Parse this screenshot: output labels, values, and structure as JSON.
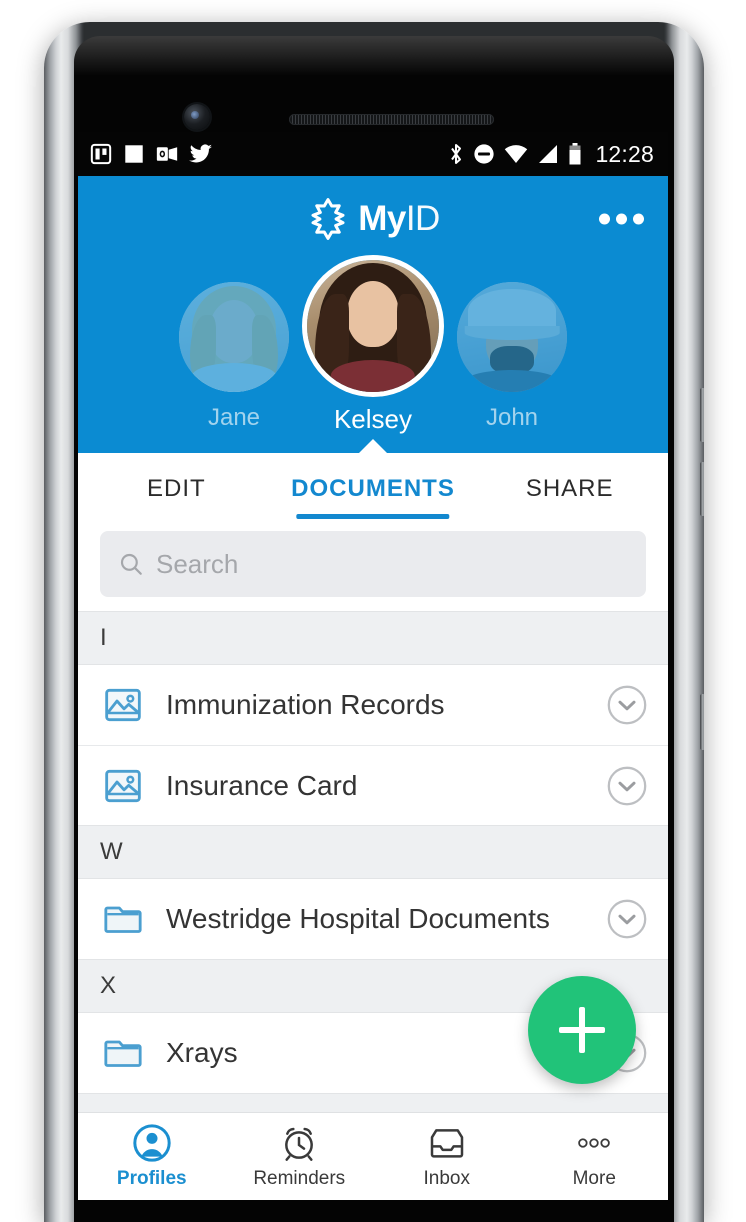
{
  "status_bar": {
    "left_icons": [
      "trello-icon",
      "white-square-icon",
      "outlook-icon",
      "twitter-icon"
    ],
    "right_icons": [
      "bluetooth-icon",
      "do-not-disturb-icon",
      "wifi-icon",
      "cellular-signal-icon",
      "battery-icon"
    ],
    "clock": "12:28"
  },
  "header": {
    "brand_my": "My",
    "brand_id": "ID",
    "logo_icon": "star-of-life-icon",
    "overflow_icon": "more-options-icon",
    "accent_color": "#0b8bd2"
  },
  "profiles": [
    {
      "name": "Jane",
      "active": false
    },
    {
      "name": "Kelsey",
      "active": true
    },
    {
      "name": "John",
      "active": false
    }
  ],
  "tabs": [
    {
      "label": "EDIT",
      "active": false
    },
    {
      "label": "DOCUMENTS",
      "active": true
    },
    {
      "label": "SHARE",
      "active": false
    }
  ],
  "search": {
    "icon": "search-icon",
    "placeholder": "Search",
    "value": ""
  },
  "documents": [
    {
      "section": "I",
      "items": [
        {
          "title": "Immunization Records",
          "icon": "image-icon",
          "expand_icon": "chevron-down-circle-icon"
        },
        {
          "title": "Insurance Card",
          "icon": "image-icon",
          "expand_icon": "chevron-down-circle-icon"
        }
      ]
    },
    {
      "section": "W",
      "items": [
        {
          "title": "Westridge Hospital Documents",
          "icon": "folder-icon",
          "expand_icon": "chevron-down-circle-icon"
        }
      ]
    },
    {
      "section": "X",
      "items": [
        {
          "title": "Xrays",
          "icon": "folder-icon",
          "expand_icon": "chevron-down-circle-icon"
        }
      ]
    }
  ],
  "fab": {
    "icon": "plus-icon",
    "label": "Add",
    "color": "#21c379"
  },
  "bottom_nav": [
    {
      "label": "Profiles",
      "icon": "person-circle-icon",
      "active": true
    },
    {
      "label": "Reminders",
      "icon": "alarm-clock-icon",
      "active": false
    },
    {
      "label": "Inbox",
      "icon": "inbox-tray-icon",
      "active": false
    },
    {
      "label": "More",
      "icon": "more-dots-icon",
      "active": false
    }
  ]
}
